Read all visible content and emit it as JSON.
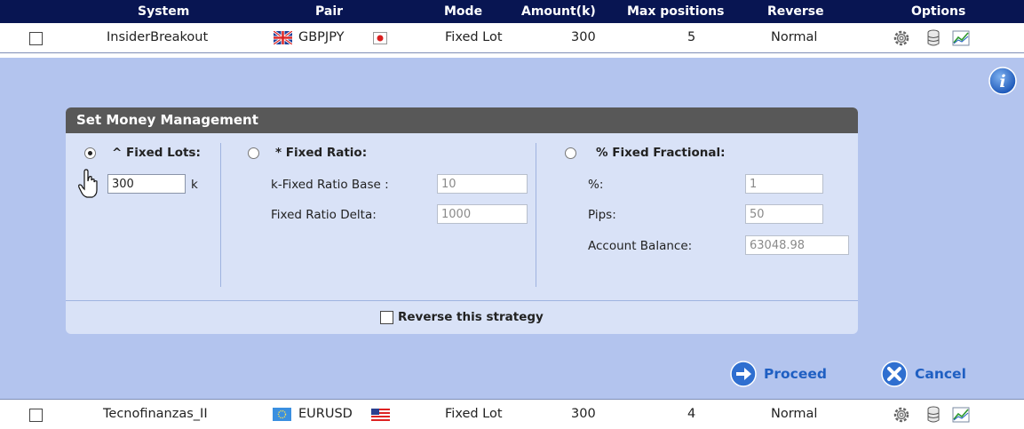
{
  "header": {
    "system": "System",
    "pair": "Pair",
    "mode": "Mode",
    "amount": "Amount(k)",
    "max_positions": "Max positions",
    "reverse": "Reverse",
    "options": "Options"
  },
  "rows": [
    {
      "system": "InsiderBreakout",
      "pair": "GBPJPY",
      "mode": "Fixed Lot",
      "amount": "300",
      "max_positions": "5",
      "reverse": "Normal"
    },
    {
      "system": "Tecnofinanzas_II",
      "pair": "EURUSD",
      "mode": "Fixed Lot",
      "amount": "300",
      "max_positions": "4",
      "reverse": "Normal"
    }
  ],
  "dialog": {
    "title": "Set Money Management",
    "fixed_lots": {
      "label": "^ Fixed Lots:",
      "value": "300",
      "unit": "k",
      "selected": true
    },
    "fixed_ratio": {
      "label": "* Fixed Ratio:",
      "base_label": "k-Fixed Ratio Base :",
      "base_value": "10",
      "delta_label": "Fixed Ratio Delta:",
      "delta_value": "1000"
    },
    "fixed_fractional": {
      "label": "% Fixed Fractional:",
      "percent_label": "%:",
      "percent_value": "1",
      "pips_label": "Pips:",
      "pips_value": "50",
      "balance_label": "Account Balance:",
      "balance_value": "63048.98"
    },
    "reverse_label": "Reverse this strategy"
  },
  "buttons": {
    "proceed": "Proceed",
    "cancel": "Cancel"
  },
  "colors": {
    "header_bg": "#081552",
    "panel_bg": "#b3c4ee",
    "card_bg": "#d9e2f7",
    "card_title_bg": "#585858",
    "accent_blue": "#1f5fc2"
  }
}
